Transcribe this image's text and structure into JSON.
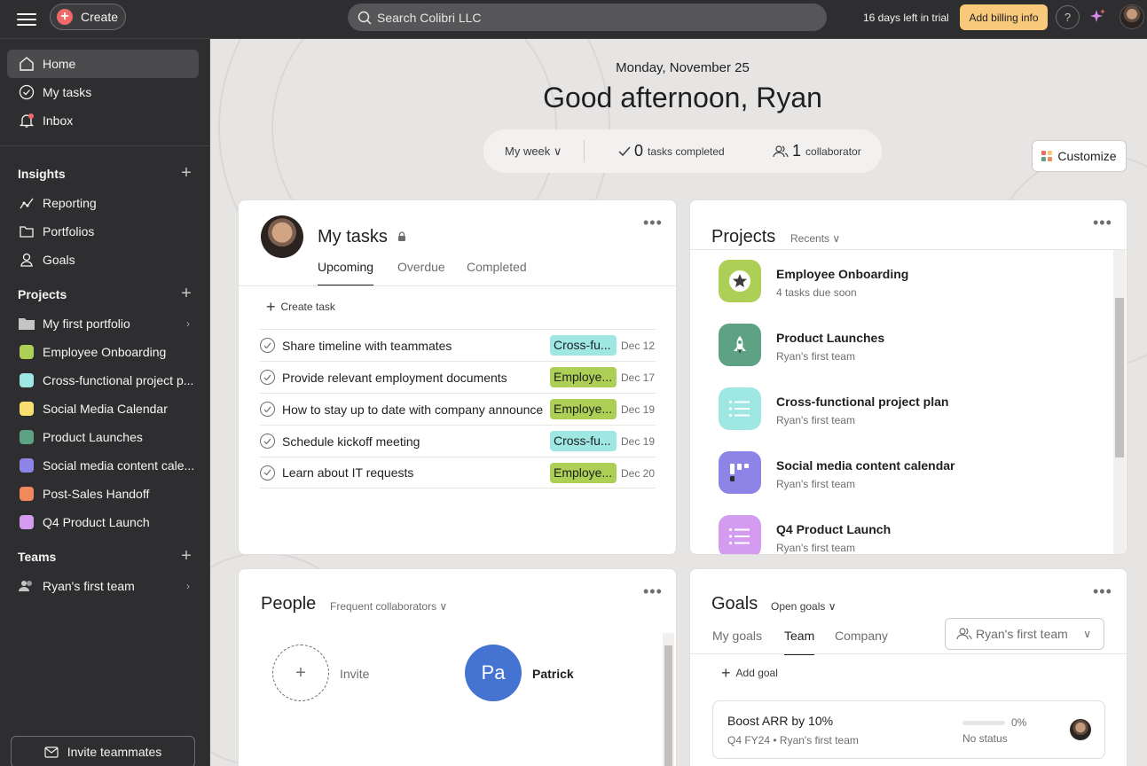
{
  "topbar": {
    "create_label": "Create",
    "search_placeholder": "Search Colibri LLC",
    "trial_text": "16 days left in trial",
    "billing_label": "Add billing info",
    "help_label": "?"
  },
  "sidebar": {
    "nav": [
      {
        "label": "Home",
        "icon": "home-icon"
      },
      {
        "label": "My tasks",
        "icon": "check-circle-icon"
      },
      {
        "label": "Inbox",
        "icon": "bell-icon"
      }
    ],
    "insights_heading": "Insights",
    "insights": [
      {
        "label": "Reporting",
        "icon": "chart-line-icon"
      },
      {
        "label": "Portfolios",
        "icon": "folder-icon"
      },
      {
        "label": "Goals",
        "icon": "person-goal-icon"
      }
    ],
    "projects_heading": "Projects",
    "projects": [
      {
        "label": "My first portfolio",
        "color": "#c7c4c4"
      },
      {
        "label": "Employee Onboarding",
        "color": "#aecf55"
      },
      {
        "label": "Cross-functional project p...",
        "color": "#9ee7e3"
      },
      {
        "label": "Social Media Calendar",
        "color": "#f8df72"
      },
      {
        "label": "Product Launches",
        "color": "#5da283"
      },
      {
        "label": "Social media content cale...",
        "color": "#8d84e8"
      },
      {
        "label": "Post-Sales Handoff",
        "color": "#f1895e"
      },
      {
        "label": "Q4 Product Launch",
        "color": "#d39cf0"
      }
    ],
    "teams_heading": "Teams",
    "teams": [
      {
        "label": "Ryan's first team"
      }
    ],
    "invite_label": "Invite teammates"
  },
  "header": {
    "date": "Monday, November 25",
    "greeting": "Good afternoon, Ryan",
    "week_label": "My week",
    "tasks_completed_count": "0",
    "tasks_completed_label": "tasks completed",
    "collaborator_count": "1",
    "collaborator_label": "collaborator",
    "customize_label": "Customize"
  },
  "my_tasks": {
    "title": "My tasks",
    "tabs": [
      "Upcoming",
      "Overdue",
      "Completed"
    ],
    "create_task_label": "Create task",
    "tasks": [
      {
        "name": "Share timeline with teammates",
        "tag": "Cross-fu...",
        "tag_color": "#9ee7e3",
        "due": "Dec 12"
      },
      {
        "name": "Provide relevant employment documents",
        "tag": "Employe...",
        "tag_color": "#aecf55",
        "due": "Dec 17"
      },
      {
        "name": "How to stay up to date with company announce",
        "tag": "Employe...",
        "tag_color": "#aecf55",
        "due": "Dec 19"
      },
      {
        "name": "Schedule kickoff meeting",
        "tag": "Cross-fu...",
        "tag_color": "#9ee7e3",
        "due": "Dec 19"
      },
      {
        "name": "Learn about IT requests",
        "tag": "Employe...",
        "tag_color": "#aecf55",
        "due": "Dec 20"
      }
    ]
  },
  "projects_card": {
    "title": "Projects",
    "filter": "Recents",
    "items": [
      {
        "name": "Employee Onboarding",
        "sub": "4 tasks due soon",
        "color": "#aecf55",
        "icon": "star-icon"
      },
      {
        "name": "Product Launches",
        "sub": "Ryan's first team",
        "color": "#5da283",
        "icon": "rocket-icon"
      },
      {
        "name": "Cross-functional project plan",
        "sub": "Ryan's first team",
        "color": "#9ee7e3",
        "icon": "list-icon"
      },
      {
        "name": "Social media content calendar",
        "sub": "Ryan's first team",
        "color": "#8d84e8",
        "icon": "board-icon"
      },
      {
        "name": "Q4 Product Launch",
        "sub": "Ryan's first team",
        "color": "#d39cf0",
        "icon": "list-icon"
      }
    ]
  },
  "people_card": {
    "title": "People",
    "filter": "Frequent collaborators",
    "invite_label": "Invite",
    "person_initials": "Pa",
    "person_name": "Patrick"
  },
  "goals_card": {
    "title": "Goals",
    "filter": "Open goals",
    "tabs": [
      "My goals",
      "Team",
      "Company"
    ],
    "team_select": "Ryan's first team",
    "add_goal_label": "Add goal",
    "goal": {
      "name": "Boost ARR by 10%",
      "period": "Q4 FY24",
      "team": "Ryan's first team",
      "progress_percent": 0,
      "progress_label": "0%",
      "status": "No status"
    }
  }
}
